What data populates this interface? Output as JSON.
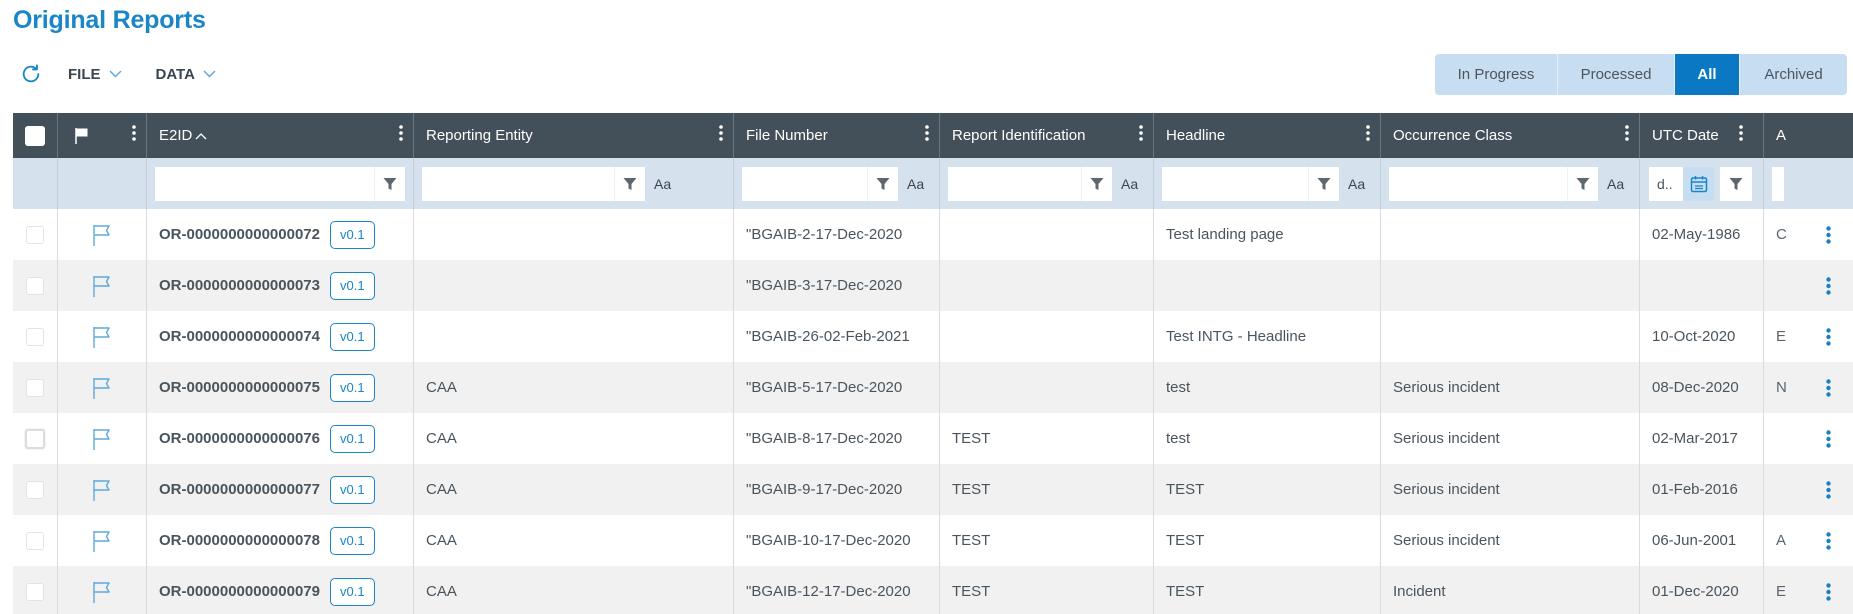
{
  "page": {
    "title": "Original Reports"
  },
  "toolbar": {
    "refresh_icon": "refresh-icon",
    "file_label": "FILE",
    "data_label": "DATA"
  },
  "status_tabs": [
    {
      "label": "In Progress",
      "active": false
    },
    {
      "label": "Processed",
      "active": false
    },
    {
      "label": "All",
      "active": true
    },
    {
      "label": "Archived",
      "active": false
    }
  ],
  "colors": {
    "accent": "#0a78c2",
    "title": "#1a86c7",
    "header_bg": "#434f59",
    "filter_bg": "#d5e1ec",
    "segment_bg": "#c7ddf1",
    "alt_row": "#f1f1f1"
  },
  "columns": [
    {
      "key": "select",
      "label": ""
    },
    {
      "key": "flag",
      "label": ""
    },
    {
      "key": "e2id",
      "label": "E2ID",
      "sort": "ascending"
    },
    {
      "key": "reporting_entity",
      "label": "Reporting Entity"
    },
    {
      "key": "file_number",
      "label": "File Number"
    },
    {
      "key": "report_identification",
      "label": "Report Identification"
    },
    {
      "key": "headline",
      "label": "Headline"
    },
    {
      "key": "occurrence_class",
      "label": "Occurrence Class"
    },
    {
      "key": "utc_date",
      "label": "UTC Date"
    },
    {
      "key": "a",
      "label": "A"
    }
  ],
  "filters": {
    "e2id": "",
    "reporting_entity": "",
    "file_number": "",
    "report_identification": "",
    "headline": "",
    "occurrence_class": "",
    "utc_date_placeholder": "d..",
    "case_label": "Aa"
  },
  "rows": [
    {
      "e2id": "OR-0000000000000072",
      "version": "v0.1",
      "reporting_entity": "",
      "file_number": "\"BGAIB-2-17-Dec-2020",
      "report_identification": "",
      "headline": "Test landing page",
      "occurrence_class": "",
      "utc_date": "02-May-1986",
      "a": "C"
    },
    {
      "e2id": "OR-0000000000000073",
      "version": "v0.1",
      "reporting_entity": "",
      "file_number": "\"BGAIB-3-17-Dec-2020",
      "report_identification": "",
      "headline": "",
      "occurrence_class": "",
      "utc_date": "",
      "a": ""
    },
    {
      "e2id": "OR-0000000000000074",
      "version": "v0.1",
      "reporting_entity": "",
      "file_number": "\"BGAIB-26-02-Feb-2021",
      "report_identification": "",
      "headline": "Test INTG - Headline",
      "occurrence_class": "",
      "utc_date": "10-Oct-2020",
      "a": "E"
    },
    {
      "e2id": "OR-0000000000000075",
      "version": "v0.1",
      "reporting_entity": "CAA",
      "file_number": "\"BGAIB-5-17-Dec-2020",
      "report_identification": "",
      "headline": "test",
      "occurrence_class": "Serious incident",
      "utc_date": "08-Dec-2020",
      "a": "N"
    },
    {
      "e2id": "OR-0000000000000076",
      "version": "v0.1",
      "reporting_entity": "CAA",
      "file_number": "\"BGAIB-8-17-Dec-2020",
      "report_identification": "TEST",
      "headline": "test",
      "occurrence_class": "Serious incident",
      "utc_date": "02-Mar-2017",
      "a": ""
    },
    {
      "e2id": "OR-0000000000000077",
      "version": "v0.1",
      "reporting_entity": "CAA",
      "file_number": "\"BGAIB-9-17-Dec-2020",
      "report_identification": "TEST",
      "headline": "TEST",
      "occurrence_class": "Serious incident",
      "utc_date": "01-Feb-2016",
      "a": ""
    },
    {
      "e2id": "OR-0000000000000078",
      "version": "v0.1",
      "reporting_entity": "CAA",
      "file_number": "\"BGAIB-10-17-Dec-2020",
      "report_identification": "TEST",
      "headline": "TEST",
      "occurrence_class": "Serious incident",
      "utc_date": "06-Jun-2001",
      "a": "A"
    },
    {
      "e2id": "OR-0000000000000079",
      "version": "v0.1",
      "reporting_entity": "CAA",
      "file_number": "\"BGAIB-12-17-Dec-2020",
      "report_identification": "TEST",
      "headline": "TEST",
      "occurrence_class": "Incident",
      "utc_date": "01-Dec-2020",
      "a": "E"
    }
  ]
}
